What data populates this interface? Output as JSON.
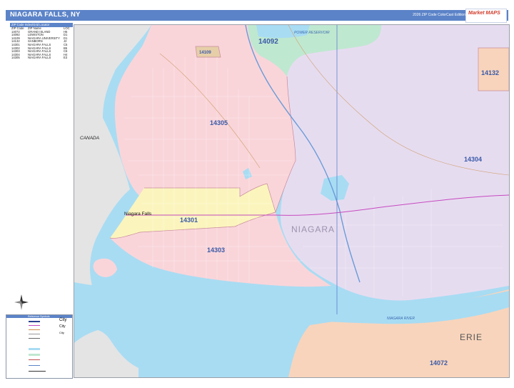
{
  "header": {
    "title": "NIAGARA FALLS, NY",
    "edition": "2026 ZIP Code ColorCast Edition",
    "logo_text": "Market MAPS"
  },
  "zip_index": {
    "title": "ZIP Code Index/Grid Locator",
    "columns": [
      "ZIP Code",
      "ZIP Name",
      "LOC"
    ],
    "rows": [
      [
        "14072",
        "GRAND ISLAND",
        "H5"
      ],
      [
        "14092",
        "LEWISTON",
        "D1"
      ],
      [
        "14109",
        "NIAGARA UNIVERSITY",
        "D1"
      ],
      [
        "14132",
        "SANBORN",
        "J2"
      ],
      [
        "14301",
        "NIAGARA FALLS",
        "C5"
      ],
      [
        "14302",
        "NIAGARA FALLS",
        "B5"
      ],
      [
        "14303",
        "NIAGARA FALLS",
        "C6"
      ],
      [
        "14304",
        "NIAGARA FALLS",
        "H4"
      ],
      [
        "14305",
        "NIAGARA FALLS",
        "E3"
      ]
    ]
  },
  "map": {
    "zip_labels": {
      "z14092": "14092",
      "z14109": "14109",
      "z14132": "14132",
      "z14305": "14305",
      "z14304": "14304",
      "z14301": "14301",
      "z14303": "14303",
      "z14072": "14072"
    },
    "place_labels": {
      "canada": "CANADA",
      "niagara": "NIAGARA",
      "erie": "ERIE",
      "niagara_falls": "Niagara Falls",
      "power_reservoir": "POWER RESERVOIR",
      "niagara_river": "NIAGARA RIVER"
    },
    "colors": {
      "water": "#a8dcf3",
      "canada_land": "#e4e4e4",
      "z14305": "#f9d5da",
      "z14303": "#f9d5da",
      "z14304": "#e6dcf0",
      "z14301": "#fbf5bd",
      "z14092": "#bfe8d0",
      "z14132": "#f8d4bc",
      "z14072": "#f8d4bc",
      "z14109": "#e6cfa8",
      "zip_label": "#3a5aa8",
      "highway": "#c64ac0"
    }
  },
  "legend": {
    "title": "Reference Symbols",
    "city_big": "City",
    "city_mid": "City",
    "city_small": "City"
  }
}
